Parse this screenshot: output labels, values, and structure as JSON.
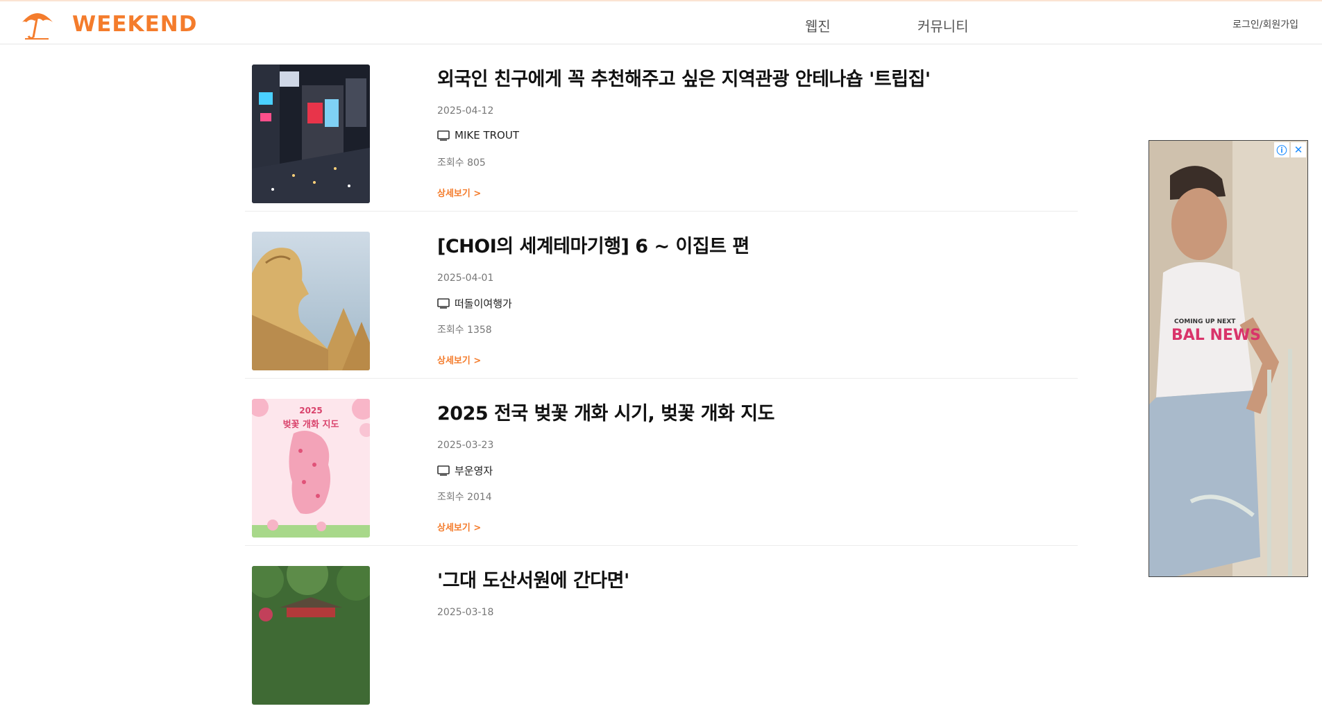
{
  "header": {
    "logo_text": "WEEKEND",
    "nav": [
      {
        "label": "웹진"
      },
      {
        "label": "커뮤니티"
      }
    ],
    "login_label": "로그인/회원가입"
  },
  "colors": {
    "brand": "#f47c2c"
  },
  "articles": [
    {
      "title": "외국인 친구에게 꼭 추천해주고 싶은 지역관광 안테나숍 '트립집'",
      "date": "2025-04-12",
      "author": "MIKE TROUT",
      "views": "조회수 805",
      "detail_label": "상세보기 >",
      "thumb": "city-night-icon"
    },
    {
      "title": "[CHOI의 세계테마기행] 6 ~ 이집트 편",
      "date": "2025-04-01",
      "author": "떠돌이여행가",
      "views": "조회수 1358",
      "detail_label": "상세보기 >",
      "thumb": "sphinx-icon"
    },
    {
      "title": "2025 전국 벚꽃 개화 시기, 벚꽃 개화 지도",
      "date": "2025-03-23",
      "author": "부운영자",
      "views": "조회수 2014",
      "detail_label": "상세보기 >",
      "thumb": "cherry-map-icon",
      "thumb_text": {
        "year": "2025",
        "caption": "벚꽃 개화 지도"
      }
    },
    {
      "title": "'그대 도산서원에 간다면'",
      "date": "2025-03-18",
      "author": "",
      "views": "",
      "detail_label": "",
      "thumb": "forest-temple-icon"
    }
  ],
  "ad": {
    "shirt_line1": "COMING UP NEXT",
    "shirt_line2": "BAL NEWS",
    "info_icon": "info-icon",
    "close_icon": "close-icon"
  }
}
